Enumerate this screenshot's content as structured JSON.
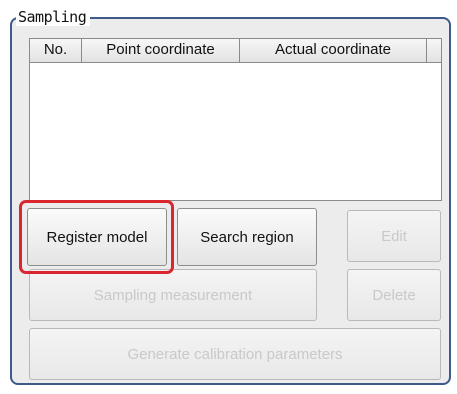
{
  "group": {
    "title": "Sampling"
  },
  "table": {
    "columns": [
      "No.",
      "Point coordinate",
      "Actual coordinate",
      ""
    ],
    "rows": []
  },
  "buttons": {
    "register_model": "Register model",
    "search_region": "Search region",
    "edit": "Edit",
    "sampling_measurement": "Sampling measurement",
    "delete": "Delete",
    "generate_calibration": "Generate calibration parameters"
  },
  "colors": {
    "highlight": "#d9262f",
    "group_border": "#3c5a8a"
  }
}
